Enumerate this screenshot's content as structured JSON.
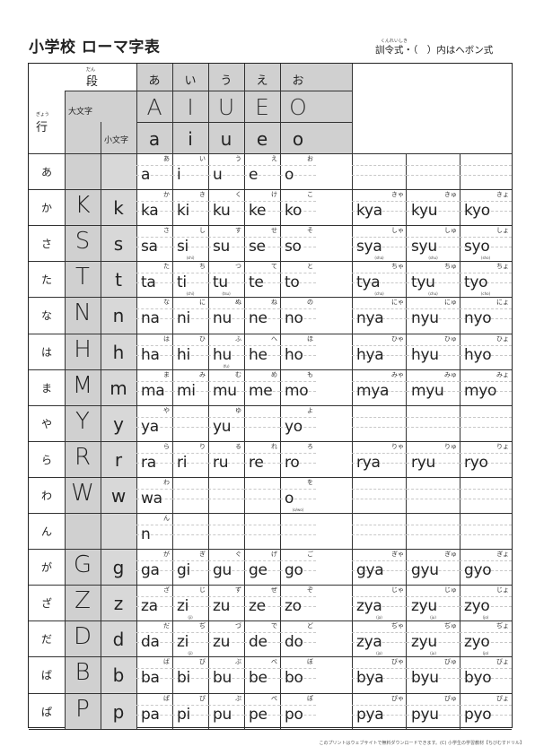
{
  "title": "小学校 ローマ字表",
  "subtitle": "訓令式・（　）内はヘボン式",
  "subtitle_ruby": "くんれいしき",
  "header": {
    "dan_ruby": "だん",
    "dan": "段",
    "gyo_ruby": "ぎょう",
    "gyo": "行",
    "daimoji": "大文字",
    "komoji": "小文字",
    "kana": [
      "あ",
      "い",
      "う",
      "え",
      "お"
    ],
    "upper": [
      "A",
      "I",
      "U",
      "E",
      "O"
    ],
    "lower": [
      "a",
      "i",
      "u",
      "e",
      "o"
    ]
  },
  "rows": [
    {
      "label": "あ",
      "up": "",
      "low": "",
      "cells": [
        [
          "あ",
          "a",
          ""
        ],
        [
          "い",
          "i",
          ""
        ],
        [
          "う",
          "u",
          ""
        ],
        [
          "え",
          "e",
          ""
        ],
        [
          "お",
          "o",
          ""
        ]
      ],
      "yoon": []
    },
    {
      "label": "か",
      "up": "K",
      "low": "k",
      "cells": [
        [
          "か",
          "ka",
          ""
        ],
        [
          "き",
          "ki",
          ""
        ],
        [
          "く",
          "ku",
          ""
        ],
        [
          "け",
          "ke",
          ""
        ],
        [
          "こ",
          "ko",
          ""
        ]
      ],
      "yoon": [
        [
          "きゃ",
          "kya",
          ""
        ],
        [
          "きゅ",
          "kyu",
          ""
        ],
        [
          "きょ",
          "kyo",
          ""
        ]
      ]
    },
    {
      "label": "さ",
      "up": "S",
      "low": "s",
      "cells": [
        [
          "さ",
          "sa",
          ""
        ],
        [
          "し",
          "si",
          "(shi)"
        ],
        [
          "す",
          "su",
          ""
        ],
        [
          "せ",
          "se",
          ""
        ],
        [
          "そ",
          "so",
          ""
        ]
      ],
      "yoon": [
        [
          "しゃ",
          "sya",
          "(sha)"
        ],
        [
          "しゅ",
          "syu",
          "(shu)"
        ],
        [
          "しょ",
          "syo",
          "(sho)"
        ]
      ]
    },
    {
      "label": "た",
      "up": "T",
      "low": "t",
      "cells": [
        [
          "た",
          "ta",
          ""
        ],
        [
          "ち",
          "ti",
          "(chi)"
        ],
        [
          "つ",
          "tu",
          "(tsu)"
        ],
        [
          "て",
          "te",
          ""
        ],
        [
          "と",
          "to",
          ""
        ]
      ],
      "yoon": [
        [
          "ちゃ",
          "tya",
          "(cha)"
        ],
        [
          "ちゅ",
          "tyu",
          "(chu)"
        ],
        [
          "ちょ",
          "tyo",
          "(cho)"
        ]
      ]
    },
    {
      "label": "な",
      "up": "N",
      "low": "n",
      "cells": [
        [
          "な",
          "na",
          ""
        ],
        [
          "に",
          "ni",
          ""
        ],
        [
          "ぬ",
          "nu",
          ""
        ],
        [
          "ね",
          "ne",
          ""
        ],
        [
          "の",
          "no",
          ""
        ]
      ],
      "yoon": [
        [
          "にゃ",
          "nya",
          ""
        ],
        [
          "にゅ",
          "nyu",
          ""
        ],
        [
          "にょ",
          "nyo",
          ""
        ]
      ]
    },
    {
      "label": "は",
      "up": "H",
      "low": "h",
      "cells": [
        [
          "は",
          "ha",
          ""
        ],
        [
          "ひ",
          "hi",
          ""
        ],
        [
          "ふ",
          "hu",
          "(fu)"
        ],
        [
          "へ",
          "he",
          ""
        ],
        [
          "ほ",
          "ho",
          ""
        ]
      ],
      "yoon": [
        [
          "ひゃ",
          "hya",
          ""
        ],
        [
          "ひゅ",
          "hyu",
          ""
        ],
        [
          "ひょ",
          "hyo",
          ""
        ]
      ]
    },
    {
      "label": "ま",
      "up": "M",
      "low": "m",
      "cells": [
        [
          "ま",
          "ma",
          ""
        ],
        [
          "み",
          "mi",
          ""
        ],
        [
          "む",
          "mu",
          ""
        ],
        [
          "め",
          "me",
          ""
        ],
        [
          "も",
          "mo",
          ""
        ]
      ],
      "yoon": [
        [
          "みゃ",
          "mya",
          ""
        ],
        [
          "みゅ",
          "myu",
          ""
        ],
        [
          "みょ",
          "myo",
          ""
        ]
      ]
    },
    {
      "label": "や",
      "up": "Y",
      "low": "y",
      "cells": [
        [
          "や",
          "ya",
          ""
        ],
        [
          "",
          "",
          ""
        ],
        [
          "ゆ",
          "yu",
          ""
        ],
        [
          "",
          "",
          ""
        ],
        [
          "よ",
          "yo",
          ""
        ]
      ],
      "yoon": []
    },
    {
      "label": "ら",
      "up": "R",
      "low": "r",
      "cells": [
        [
          "ら",
          "ra",
          ""
        ],
        [
          "り",
          "ri",
          ""
        ],
        [
          "る",
          "ru",
          ""
        ],
        [
          "れ",
          "re",
          ""
        ],
        [
          "ろ",
          "ro",
          ""
        ]
      ],
      "yoon": [
        [
          "りゃ",
          "rya",
          ""
        ],
        [
          "りゅ",
          "ryu",
          ""
        ],
        [
          "りょ",
          "ryo",
          ""
        ]
      ]
    },
    {
      "label": "わ",
      "up": "W",
      "low": "w",
      "cells": [
        [
          "わ",
          "wa",
          ""
        ],
        [
          "",
          "",
          ""
        ],
        [
          "",
          "",
          ""
        ],
        [
          "",
          "",
          ""
        ],
        [
          "を",
          "o",
          "(o/wo)"
        ]
      ],
      "yoon": []
    },
    {
      "label": "ん",
      "up": "",
      "low": "",
      "cells": [
        [
          "ん",
          "n",
          ""
        ],
        [
          "",
          "",
          ""
        ],
        [
          "",
          "",
          ""
        ],
        [
          "",
          "",
          ""
        ],
        [
          "",
          "",
          ""
        ]
      ],
      "yoon": []
    },
    {
      "label": "が",
      "up": "G",
      "low": "g",
      "cells": [
        [
          "が",
          "ga",
          ""
        ],
        [
          "ぎ",
          "gi",
          ""
        ],
        [
          "ぐ",
          "gu",
          ""
        ],
        [
          "げ",
          "ge",
          ""
        ],
        [
          "ご",
          "go",
          ""
        ]
      ],
      "yoon": [
        [
          "ぎゃ",
          "gya",
          ""
        ],
        [
          "ぎゅ",
          "gyu",
          ""
        ],
        [
          "ぎょ",
          "gyo",
          ""
        ]
      ]
    },
    {
      "label": "ざ",
      "up": "Z",
      "low": "z",
      "cells": [
        [
          "ざ",
          "za",
          ""
        ],
        [
          "じ",
          "zi",
          "(ji)"
        ],
        [
          "ず",
          "zu",
          ""
        ],
        [
          "ぜ",
          "ze",
          ""
        ],
        [
          "ぞ",
          "zo",
          ""
        ]
      ],
      "yoon": [
        [
          "じゃ",
          "zya",
          "(ja)"
        ],
        [
          "じゅ",
          "zyu",
          "(ju)"
        ],
        [
          "じょ",
          "zyo",
          "(jo)"
        ]
      ]
    },
    {
      "label": "だ",
      "up": "D",
      "low": "d",
      "cells": [
        [
          "だ",
          "da",
          ""
        ],
        [
          "ぢ",
          "zi",
          "(ji)"
        ],
        [
          "づ",
          "zu",
          ""
        ],
        [
          "で",
          "de",
          ""
        ],
        [
          "ど",
          "do",
          ""
        ]
      ],
      "yoon": [
        [
          "ぢゃ",
          "zya",
          "(ja)"
        ],
        [
          "ぢゅ",
          "zyu",
          "(ju)"
        ],
        [
          "ぢょ",
          "zyo",
          "(jo)"
        ]
      ]
    },
    {
      "label": "ば",
      "up": "B",
      "low": "b",
      "cells": [
        [
          "ば",
          "ba",
          ""
        ],
        [
          "び",
          "bi",
          ""
        ],
        [
          "ぶ",
          "bu",
          ""
        ],
        [
          "べ",
          "be",
          ""
        ],
        [
          "ぼ",
          "bo",
          ""
        ]
      ],
      "yoon": [
        [
          "びゃ",
          "bya",
          ""
        ],
        [
          "びゅ",
          "byu",
          ""
        ],
        [
          "びょ",
          "byo",
          ""
        ]
      ]
    },
    {
      "label": "ぱ",
      "up": "P",
      "low": "p",
      "cells": [
        [
          "ぱ",
          "pa",
          ""
        ],
        [
          "ぴ",
          "pi",
          ""
        ],
        [
          "ぷ",
          "pu",
          ""
        ],
        [
          "ぺ",
          "pe",
          ""
        ],
        [
          "ぽ",
          "po",
          ""
        ]
      ],
      "yoon": [
        [
          "ぴゃ",
          "pya",
          ""
        ],
        [
          "ぴゅ",
          "pyu",
          ""
        ],
        [
          "ぴょ",
          "pyo",
          ""
        ]
      ]
    }
  ],
  "footer": "このプリントはウェブサイトで無料ダウンロードできます。(C) 小学生の学習教材【ちびむすドリル】"
}
